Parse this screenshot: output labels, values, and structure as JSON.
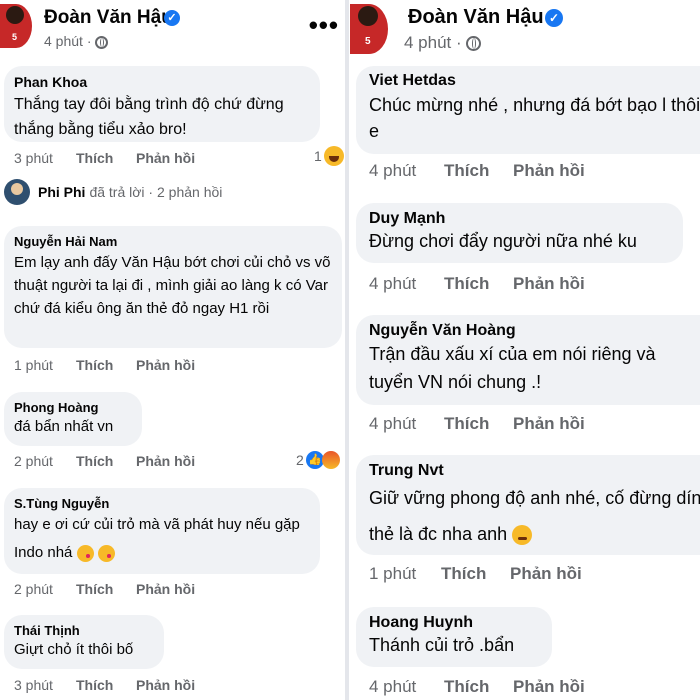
{
  "post": {
    "author": "Đoàn Văn Hậu",
    "time": "4 phút",
    "avatar_number": "5",
    "more_icon": "more-horizontal-icon",
    "verified_icon": "verified-badge-icon",
    "privacy_icon": "globe-icon"
  },
  "actions": {
    "like": "Thích",
    "reply": "Phản hồi"
  },
  "left_comments": [
    {
      "author": "Phan Khoa",
      "text": "Thắng tay đôi bằng trình độ chứ đừng thắng bằng tiểu xảo bro!",
      "time": "3 phút",
      "reaction_count": "1",
      "reactions": [
        "haha"
      ]
    },
    {
      "author": "Nguyễn Hải Nam",
      "text": "Em lạy anh đấy Văn Hậu bớt chơi củi chỏ vs võ thuật người ta lại đi , mình giải ao làng k có Var chứ đá kiểu ông ăn thẻ đỏ ngay H1 rồi",
      "time": "1 phút"
    },
    {
      "author": "Phong Hoàng",
      "text": "đá bẩn nhất vn",
      "time": "2 phút",
      "reaction_count": "2",
      "reactions": [
        "like",
        "angry"
      ]
    },
    {
      "author": "S.Tùng Nguyễn",
      "text": "hay e ơi cứ củi trỏ mà vã phát huy nếu gặp Indo nhá",
      "time": "2 phút",
      "inline_emojis": [
        "face-blowing-kiss",
        "face-blowing-kiss"
      ]
    },
    {
      "author": "Thái Thịnh",
      "text": "Giựt chỏ ít thôi bố",
      "time": "3 phút"
    }
  ],
  "reply_summary": {
    "name": "Phi Phi",
    "rest": "đã trả lời · 2 phản hồi"
  },
  "right_comments": [
    {
      "author": "Viet Hetdas",
      "text": "Chúc mừng nhé , nhưng đá bớt bạo l thôi e",
      "time": "4 phút"
    },
    {
      "author": "Duy Mạnh",
      "text": "Đừng chơi đẩy người nữa nhé ku",
      "time": "4 phút"
    },
    {
      "author": "Nguyễn Văn Hoàng",
      "text": "Trận đầu xấu xí của em nói riêng và tuyển VN nói chung .!",
      "time": "4 phút"
    },
    {
      "author": "Trung Nvt",
      "text": "Giữ vững phong độ anh nhé, cố đừng dính thẻ là đc nha anh",
      "time": "1 phút",
      "inline_emojis": [
        "persevering-face"
      ]
    },
    {
      "author": "Hoang Huynh",
      "text": "Thánh củi trỏ .bẩn",
      "time": "4 phút"
    }
  ]
}
